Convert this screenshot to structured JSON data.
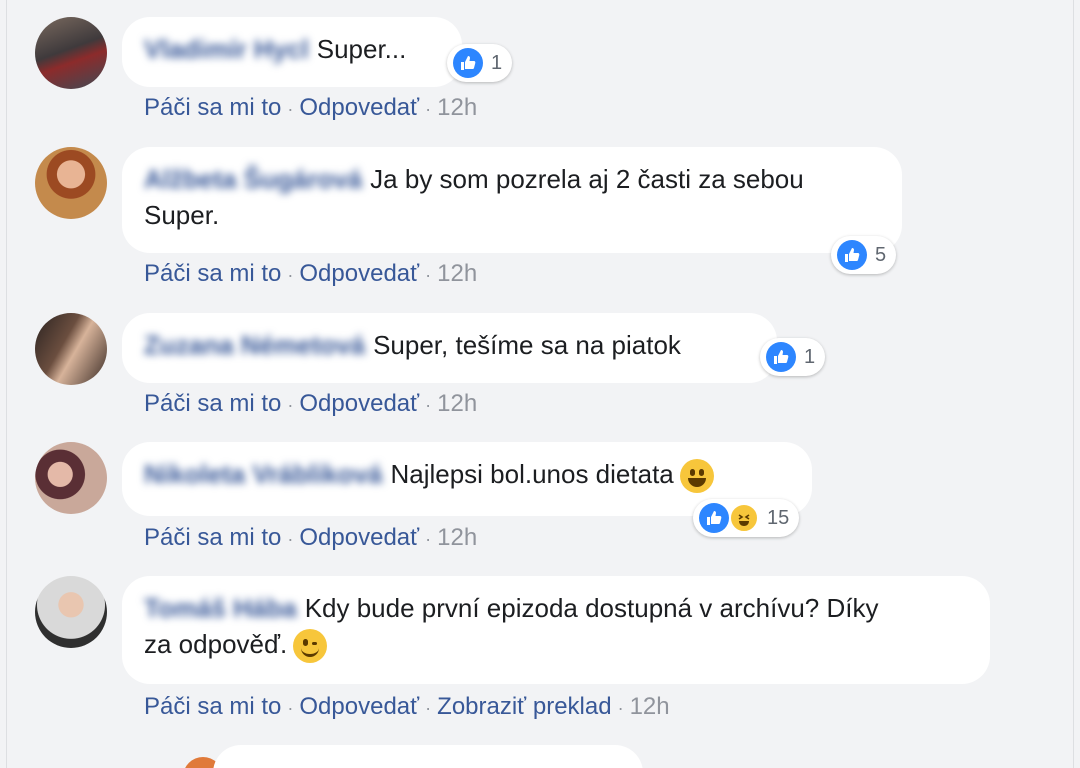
{
  "comments": [
    {
      "author": "Vladimír Hycl",
      "text_line1": "Super...",
      "text_line2": "",
      "reactions": {
        "count": "1",
        "types": [
          "like-icon"
        ]
      },
      "actions": {
        "like": "Páči sa mi to",
        "reply": "Odpovedať",
        "translate": "",
        "time": "12h"
      }
    },
    {
      "author": "Alžbeta Šugárová",
      "text_line1": "Ja by som pozrela aj 2 časti za sebou",
      "text_line2": "Super.",
      "reactions": {
        "count": "5",
        "types": [
          "like-icon"
        ]
      },
      "actions": {
        "like": "Páči sa mi to",
        "reply": "Odpovedať",
        "translate": "",
        "time": "12h"
      }
    },
    {
      "author": "Zuzana Németová",
      "text_line1": "Super, tešíme sa na piatok",
      "text_line2": "",
      "reactions": {
        "count": "1",
        "types": [
          "like-icon"
        ]
      },
      "actions": {
        "like": "Páči sa mi to",
        "reply": "Odpovedať",
        "translate": "",
        "time": "12h"
      }
    },
    {
      "author": "Nikoleta Vrábliková",
      "text_line1": "Najlepsi bol.unos dietata",
      "text_line2": "",
      "emoji": "grinning-emoji",
      "reactions": {
        "count": "15",
        "types": [
          "like-icon",
          "haha-icon"
        ]
      },
      "actions": {
        "like": "Páči sa mi to",
        "reply": "Odpovedať",
        "translate": "",
        "time": "12h"
      }
    },
    {
      "author": "Tomáš Hába",
      "text_line1": "Kdy bude první epizoda dostupná v archívu? Díky",
      "text_line2": "za odpověď.",
      "emoji": "wink-emoji",
      "reactions": null,
      "actions": {
        "like": "Páči sa mi to",
        "reply": "Odpovedať",
        "translate": "Zobraziť preklad",
        "time": "12h"
      }
    }
  ],
  "colors": {
    "background": "#f2f3f5",
    "bubble": "#ffffff",
    "link": "#385898",
    "meta": "#90949c",
    "like": "#2d86ff",
    "haha": "#f7c63b"
  }
}
